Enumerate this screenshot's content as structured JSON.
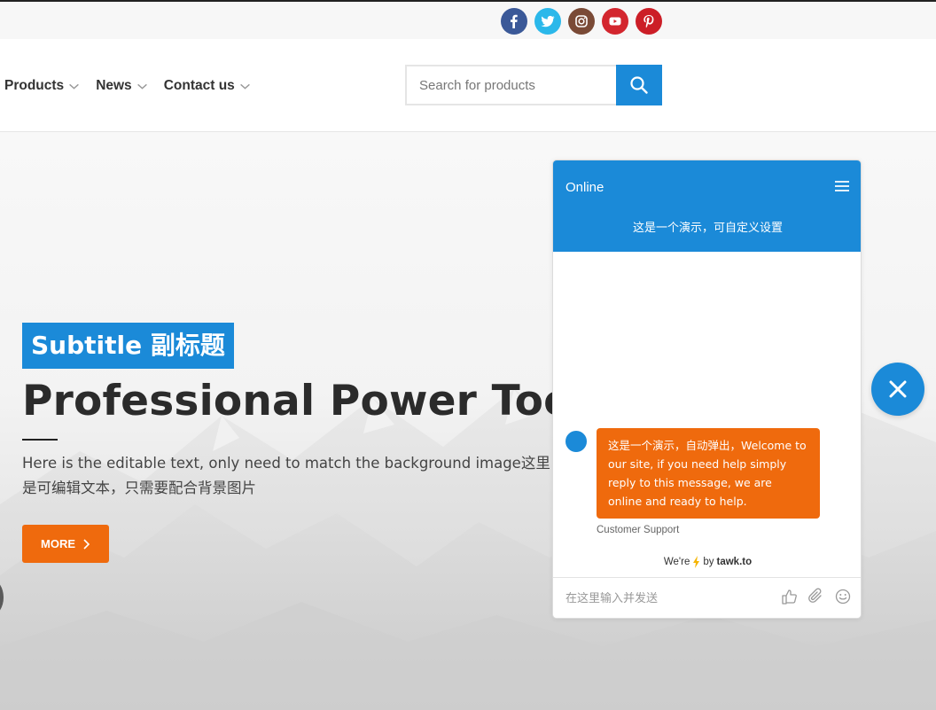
{
  "social": [
    {
      "name": "facebook",
      "icon": "facebook-icon",
      "glyph": "f",
      "color": "#3b5998"
    },
    {
      "name": "twitter",
      "icon": "twitter-icon",
      "glyph": "t",
      "color": "#2bb8ea"
    },
    {
      "name": "instagram",
      "icon": "instagram-icon",
      "glyph": "◎",
      "color": "#7a4a36"
    },
    {
      "name": "youtube",
      "icon": "youtube-icon",
      "glyph": "▶",
      "color": "#d3262e"
    },
    {
      "name": "pinterest",
      "icon": "pinterest-icon",
      "glyph": "p",
      "color": "#cc1e27"
    }
  ],
  "nav": {
    "items": [
      {
        "label": "Products"
      },
      {
        "label": "News"
      },
      {
        "label": "Contact us"
      }
    ]
  },
  "search": {
    "placeholder": "Search for products",
    "button_icon": "search-icon"
  },
  "hero": {
    "subtitle": "Subtitle 副标题",
    "title": "Professional Power Tool",
    "text": "Here is the editable text, only need to match the background image这里是可编辑文本，只需要配合背景图片",
    "more_label": "MORE"
  },
  "chat": {
    "status": "Online",
    "subtitle": "这是一个演示，可自定义设置",
    "message": "这是一个演示，自动弹出，Welcome to our site, if you need help simply reply to this message, we are online and ready to help.",
    "author": "Customer Support",
    "powered_prefix": "We're",
    "powered_by": "by",
    "powered_brand": "tawk.to",
    "input_placeholder": "在这里输入并发送"
  },
  "colors": {
    "primary": "#1b8ad8",
    "accent": "#ef6a0d",
    "title": "#2b2b2b"
  }
}
